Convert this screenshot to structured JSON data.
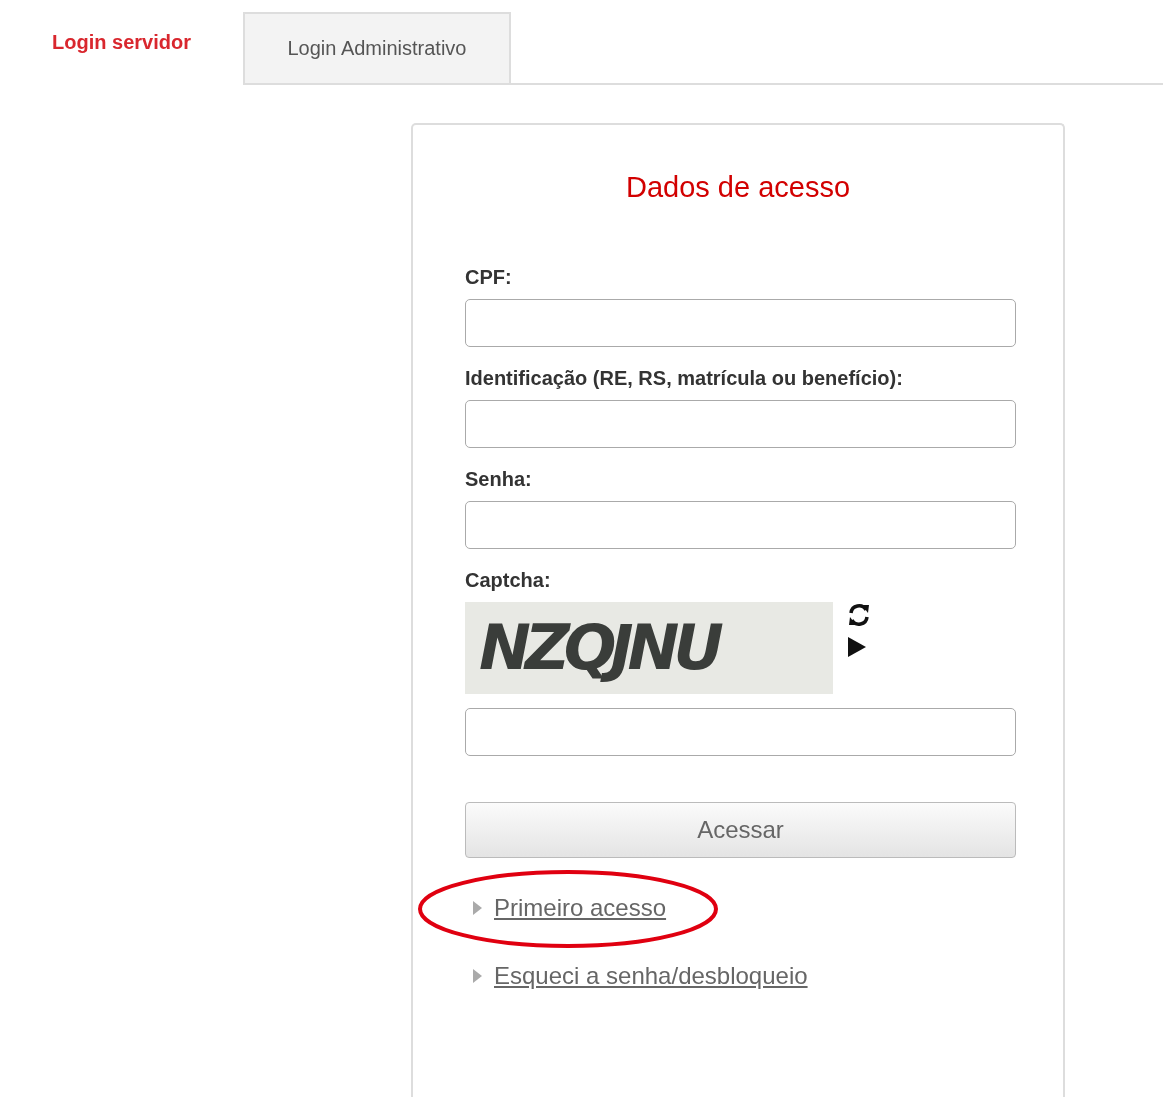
{
  "tabs": [
    {
      "label": "Login servidor",
      "selected": true
    },
    {
      "label": "Login Administrativo",
      "selected": false
    }
  ],
  "form": {
    "title": "Dados de acesso",
    "fields": [
      {
        "label": "CPF:"
      },
      {
        "label": "Identificação (RE, RS, matrícula ou benefício):"
      },
      {
        "label": "Senha:"
      }
    ],
    "captcha": {
      "label": "Captcha:",
      "text": "NZQJNU"
    },
    "submit": "Acessar",
    "links": [
      {
        "label": "Primeiro acesso",
        "highlighted": true
      },
      {
        "label": "Esqueci a senha/desbloqueio",
        "highlighted": false
      }
    ]
  }
}
